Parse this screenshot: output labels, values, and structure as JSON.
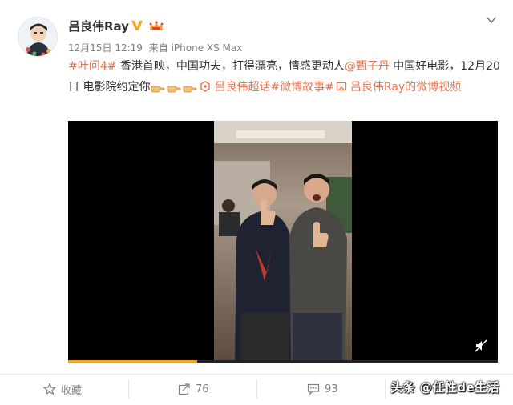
{
  "post": {
    "username": "吕良伟Ray",
    "timestamp": "12月15日 12:19",
    "source": "来自 iPhone XS Max",
    "content": {
      "hashtag_ipman": "#叶问4#",
      "text1": " 香港首映，中国功夫，打得漂亮，情感更动人",
      "mention": "@甄子丹",
      "text2": " 中国好电影，12月20日 电影院约定你",
      "supertopic": "吕良伟超话",
      "hashtag_story": "#微博故事#",
      "video_link": "吕良伟Ray的微博视频"
    },
    "icons": {
      "verified": "verified-v-badge-icon",
      "vip": "vip-crown-icon",
      "dropdown": "chevron-down-icon",
      "pointing_hand": "pointing-hand-icon",
      "supertopic": "supertopic-icon",
      "video_link": "video-link-icon",
      "mute": "mute-icon"
    },
    "video": {
      "progress": 0.3
    }
  },
  "actions": {
    "favorite_label": "收藏",
    "repost_count": "76",
    "comment_count": "93"
  },
  "watermark": "头条 @任性de生活",
  "colors": {
    "link": "#eb7350",
    "verified": "#f5a623",
    "text": "#333333",
    "meta": "#808080"
  }
}
